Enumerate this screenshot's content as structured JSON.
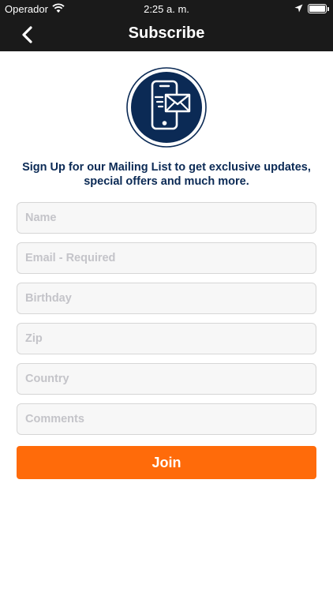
{
  "status_bar": {
    "carrier": "Operador",
    "time": "2:25 a. m."
  },
  "nav": {
    "title": "Subscribe",
    "back_icon": "chevron-left-icon"
  },
  "logo": {
    "icon": "phone-mail-icon",
    "circle_color": "#0b2a55"
  },
  "intro_text": "Sign Up for our Mailing List to get exclusive updates, special offers and much more.",
  "form": {
    "name_placeholder": "Name",
    "email_placeholder": "Email - Required",
    "birthday_placeholder": "Birthday",
    "zip_placeholder": "Zip",
    "country_placeholder": "Country",
    "comments_placeholder": "Comments",
    "join_label": "Join"
  },
  "colors": {
    "bar_background": "#1a1a1a",
    "accent": "#ff6b0a",
    "text_primary": "#0b2a55"
  }
}
